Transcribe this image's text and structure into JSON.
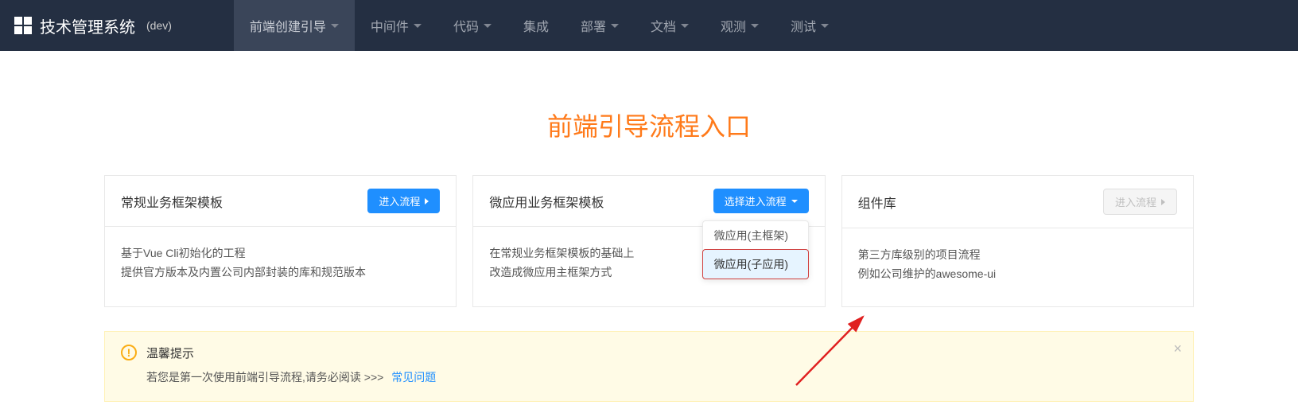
{
  "brand": {
    "title": "技术管理系统",
    "env": "(dev)"
  },
  "nav": {
    "items": [
      {
        "label": "前端创建引导",
        "caret": true,
        "active": true
      },
      {
        "label": "中间件",
        "caret": true
      },
      {
        "label": "代码",
        "caret": true
      },
      {
        "label": "集成",
        "caret": false
      },
      {
        "label": "部署",
        "caret": true
      },
      {
        "label": "文档",
        "caret": true
      },
      {
        "label": "观测",
        "caret": true
      },
      {
        "label": "测试",
        "caret": true
      }
    ]
  },
  "page": {
    "title": "前端引导流程入口"
  },
  "cards": [
    {
      "title": "常规业务框架模板",
      "button": {
        "label": "进入流程",
        "style": "primary",
        "icon": "chevron-right"
      },
      "desc1": "基于Vue Cli初始化的工程",
      "desc2": "提供官方版本及内置公司内部封装的库和规范版本"
    },
    {
      "title": "微应用业务框架模板",
      "button": {
        "label": "选择进入流程",
        "style": "primary",
        "icon": "caret-down"
      },
      "desc1": "在常规业务框架模板的基础上",
      "desc2": "改造成微应用主框架方式",
      "dropdown": [
        {
          "label": "微应用(主框架)"
        },
        {
          "label": "微应用(子应用)",
          "hover": true
        }
      ]
    },
    {
      "title": "组件库",
      "button": {
        "label": "进入流程",
        "style": "disabled",
        "icon": "chevron-right"
      },
      "desc1": "第三方库级别的项目流程",
      "desc2": "例如公司维护的awesome-ui"
    }
  ],
  "alert": {
    "title": "温馨提示",
    "body": "若您是第一次使用前端引导流程,请务必阅读 >>>",
    "link": "常见问题"
  }
}
